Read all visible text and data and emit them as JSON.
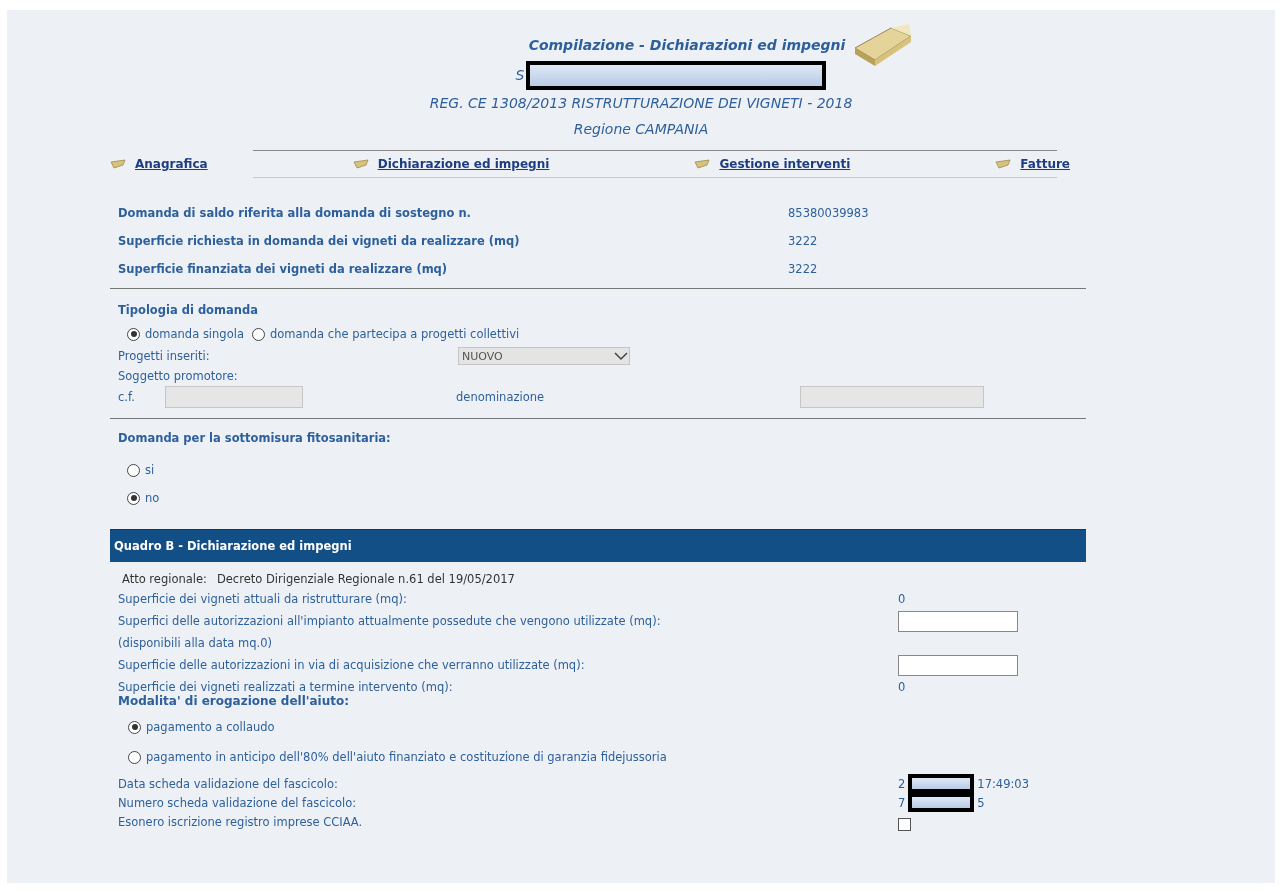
{
  "header": {
    "title": "Compilazione - Dichiarazioni ed impegni",
    "subtitle_prefix": "S",
    "regulation": "REG. CE 1308/2013 RISTRUTTURAZIONE DEI VIGNETI - 2018",
    "region": "Regione CAMPANIA"
  },
  "nav": [
    {
      "label": "Anagrafica"
    },
    {
      "label": "Dichiarazione ed impegni"
    },
    {
      "label": "Gestione interventi"
    },
    {
      "label": "Fatture"
    }
  ],
  "summary": [
    {
      "label": "Domanda di saldo riferita alla domanda di sostegno n.",
      "value": "85380039983"
    },
    {
      "label": "Superficie richiesta in domanda dei vigneti da realizzare (mq)",
      "value": "3222"
    },
    {
      "label": "Superficie finanziata dei vigneti da realizzare (mq)",
      "value": "3222"
    }
  ],
  "tipologia": {
    "title": "Tipologia di domanda",
    "options": [
      {
        "label": "domanda singola",
        "selected": true
      },
      {
        "label": "domanda che partecipa a progetti collettivi",
        "selected": false
      }
    ],
    "projects_label": "Progetti inseriti:",
    "projects_value": "NUOVO",
    "promoter_label": "Soggetto promotore:",
    "cf_label": "c.f.",
    "name_label": "denominazione"
  },
  "fitosanitaria": {
    "title": "Domanda per la sottomisura fitosanitaria:",
    "options": [
      {
        "label": "si",
        "selected": false
      },
      {
        "label": "no",
        "selected": true
      }
    ]
  },
  "quadro_b": {
    "title": "Quadro B - Dichiarazione ed impegni",
    "atto_label": "Atto regionale:",
    "atto_value": "Decreto Dirigenziale Regionale n.61 del 19/05/2017",
    "rows": [
      {
        "kind": "value",
        "label": "Superficie dei vigneti attuali da ristrutturare (mq):",
        "value": "0"
      },
      {
        "kind": "input",
        "label": "Superfici delle autorizzazioni all'impianto attualmente possedute che vengono utilizzate (mq):",
        "note": "(disponibili alla data mq.0)"
      },
      {
        "kind": "input",
        "label": "Superficie delle autorizzazioni in via di acquisizione che verranno utilizzate (mq):"
      },
      {
        "kind": "value",
        "label": "Superficie dei vigneti realizzati a termine intervento (mq):",
        "value": "0"
      }
    ],
    "payment": {
      "title": "Modalita' di erogazione dell'aiuto:",
      "options": [
        {
          "label": "pagamento a collaudo",
          "selected": true
        },
        {
          "label": "pagamento in anticipo dell'80% dell'aiuto finanziato e costituzione di garanzia fidejussoria",
          "selected": false
        }
      ]
    },
    "fascicolo": [
      {
        "kind": "redacted",
        "label": "Data scheda validazione del fascicolo:",
        "value_start": "2",
        "value_end": "17:49:03"
      },
      {
        "kind": "redacted",
        "label": "Numero scheda validazione del fascicolo:",
        "value_start": "7",
        "value_end": "5"
      },
      {
        "kind": "checkbox",
        "label": "Esonero iscrizione registro imprese CCIAA.",
        "checked": false
      }
    ]
  }
}
